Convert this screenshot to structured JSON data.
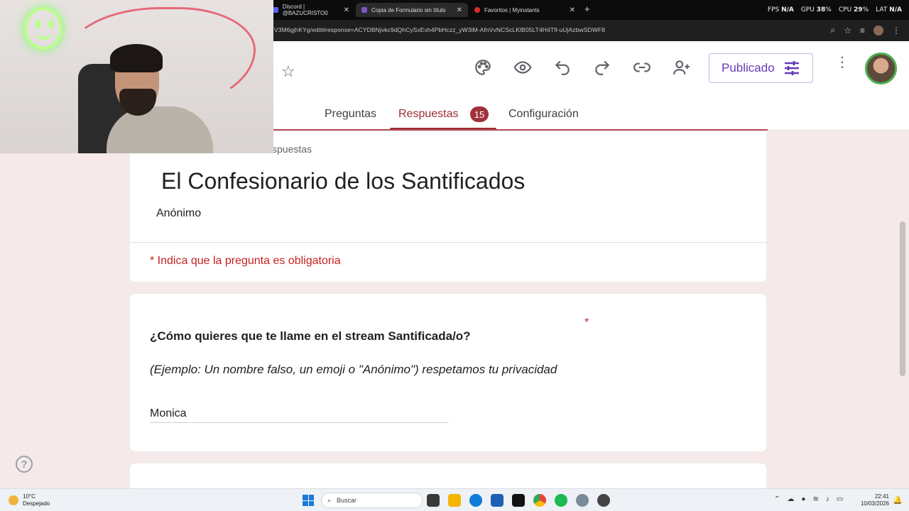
{
  "browser": {
    "tabs": [
      {
        "title": "Discord | @BAZUCRISTO0",
        "active": false,
        "color": "#5865f2"
      },
      {
        "title": "Copia de Formulario sin título",
        "active": true,
        "color": "#7e57c2"
      },
      {
        "title": "Favoritos | Myinstants",
        "active": false,
        "color": "#d93025"
      }
    ],
    "new_tab": "+",
    "close": "✕",
    "url": "V3M6gjhKYg/edit#response=ACYDBNjvkc9dQhCySxExh4PbHczz_yW3iM-AfnVvNCScLKlB05LT4H4Tfl-uUjAzbwSDWF8",
    "stats": {
      "fps_label": "FPS",
      "fps_value": "N/A",
      "gpu_label": "GPU",
      "gpu_value": "38",
      "cpu_label": "CPU",
      "cpu_value": "29",
      "lat_label": "LAT",
      "lat_value": "N/A",
      "percent": "%"
    }
  },
  "form_header": {
    "publish_label": "Publicado",
    "tabs": {
      "questions": "Preguntas",
      "responses": "Respuestas",
      "responses_count": "15",
      "settings": "Configuración"
    }
  },
  "content": {
    "breadcrumb": "spuestas",
    "form_title": "El Confesionario de los Santificados",
    "form_subtitle": "Anónimo",
    "required_note": "* Indica que la pregunta es obligatoria",
    "question": {
      "required_mark": "*",
      "title": "¿Cómo quieres que te llame en el stream Santificada/o?",
      "description": "(Ejemplo: Un nombre falso, un emoji o \"Anónimo\") respetamos tu privacidad",
      "answer": "Monica"
    }
  },
  "help_icon": "?",
  "taskbar": {
    "temperature": "10°C",
    "weather": "Despejado",
    "search_placeholder": "Buscar",
    "time": "22:41",
    "date": "10/03/2026"
  }
}
